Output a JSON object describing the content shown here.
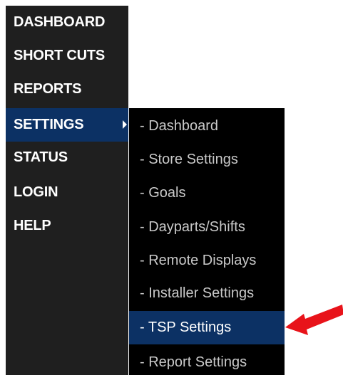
{
  "menu": {
    "items": [
      {
        "label": "DASHBOARD"
      },
      {
        "label": "SHORT CUTS"
      },
      {
        "label": "REPORTS"
      },
      {
        "label": "SETTINGS"
      },
      {
        "label": "STATUS"
      },
      {
        "label": "LOGIN"
      },
      {
        "label": "HELP"
      }
    ],
    "active": "SETTINGS"
  },
  "settings_submenu": {
    "items": [
      {
        "label": "- Dashboard"
      },
      {
        "label": "- Store Settings"
      },
      {
        "label": "- Goals"
      },
      {
        "label": "- Dayparts/Shifts"
      },
      {
        "label": "- Remote Displays"
      },
      {
        "label": "- Installer Settings"
      },
      {
        "label": "- TSP Settings"
      },
      {
        "label": "- Report Settings"
      }
    ],
    "highlighted": "- TSP Settings"
  },
  "colors": {
    "menu_background": "#1f1f1f",
    "submenu_background": "#000000",
    "active_background": "#0c3164",
    "annotation_arrow": "#e8131a"
  },
  "annotation": {
    "icon": "red-arrow-pointer-icon"
  }
}
